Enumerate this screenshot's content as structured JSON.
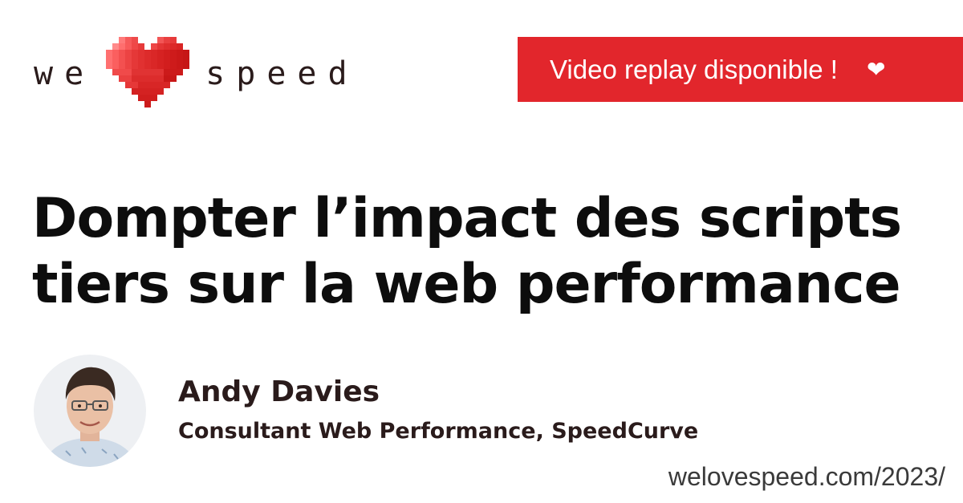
{
  "logo": {
    "word_left": "we",
    "word_right": "speed",
    "heart_icon": "pixel-heart-icon",
    "heart_colors": [
      "#ff6b6b",
      "#e32b2b",
      "#c41919"
    ]
  },
  "badge": {
    "label": "Video replay disponible !",
    "icon_glyph": "❤",
    "icon_name": "heart-icon",
    "color": "#e2262c"
  },
  "title": {
    "line1": "Dompter l’impact des scripts",
    "line2": "tiers sur la web performance"
  },
  "speaker": {
    "name": "Andy Davies",
    "role": "Consultant Web Performance, SpeedCurve",
    "avatar": "speaker-photo"
  },
  "footer": {
    "url": "welovespeed.com/2023/"
  }
}
